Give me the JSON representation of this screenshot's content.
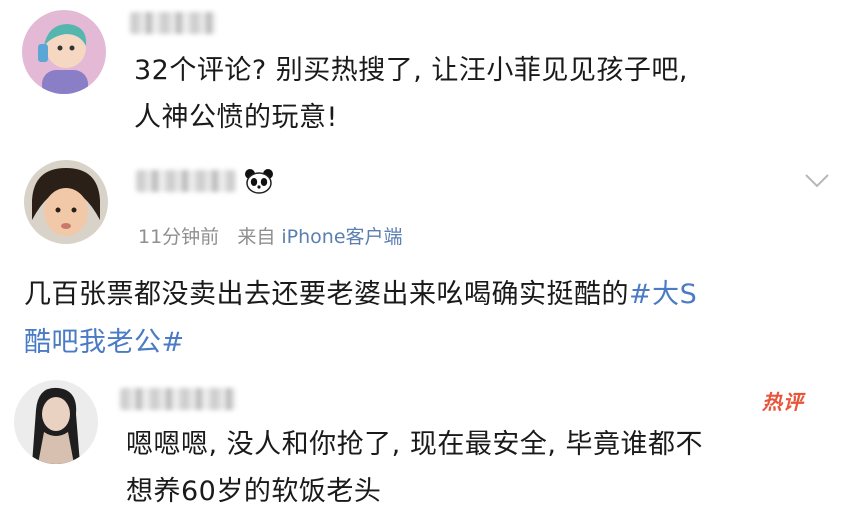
{
  "comments": [
    {
      "text_lines": [
        "32个评论? 别买热搜了, 让汪小菲见见孩子吧,",
        "人神公愤的玩意!"
      ]
    },
    {
      "time": "11分钟前",
      "source_prefix": "来自",
      "source_client": "iPhone客户端",
      "text_line1_plain": "几百张票都没卖出去还要老婆出来吆喝确实挺酷的",
      "text_line1_tag": "#大S",
      "text_line2_tag": "酷吧我老公#"
    },
    {
      "badge": "热评",
      "text_lines": [
        "嗯嗯嗯, 没人和你抢了, 现在最安全, 毕竟谁都不",
        "想养60岁的软饭老头"
      ]
    }
  ],
  "colors": {
    "text": "#1a1a1a",
    "meta": "#8f8f8f",
    "hashtag": "#4a7bc4",
    "hot": "#e8553a"
  },
  "icons": [
    "cartoon-avatar-icon",
    "panda-emoji-icon",
    "chevron-down-icon"
  ]
}
